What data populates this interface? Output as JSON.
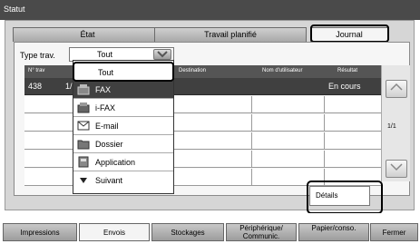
{
  "window": {
    "title": "Statut"
  },
  "tabs": [
    {
      "label": "État"
    },
    {
      "label": "Travail planifié"
    },
    {
      "label": "Journal"
    }
  ],
  "filter": {
    "label": "Type trav.",
    "value": "Tout"
  },
  "table": {
    "columns": [
      "N° trav",
      "Destination",
      "Nom d'utilisateur",
      "Résultat"
    ],
    "rows": [
      {
        "num": "438",
        "extra": "1/",
        "result": "En cours"
      }
    ]
  },
  "dropdown": {
    "items": [
      {
        "label": "Tout",
        "icon": "none"
      },
      {
        "label": "FAX",
        "icon": "fax-icon"
      },
      {
        "label": "i-FAX",
        "icon": "ifax-icon"
      },
      {
        "label": "E-mail",
        "icon": "email-icon"
      },
      {
        "label": "Dossier",
        "icon": "folder-icon"
      },
      {
        "label": "Application",
        "icon": "application-icon"
      },
      {
        "label": "Suivant",
        "icon": "arrow-down-icon"
      }
    ]
  },
  "pager": {
    "page": "1/1"
  },
  "details_button": "Détails",
  "bottom_tabs": [
    {
      "label": "Impressions"
    },
    {
      "label": "Envois"
    },
    {
      "label": "Stockages"
    },
    {
      "label": "Périphérique/ Communic."
    },
    {
      "label": "Papier/conso."
    },
    {
      "label": "Fermer"
    }
  ]
}
